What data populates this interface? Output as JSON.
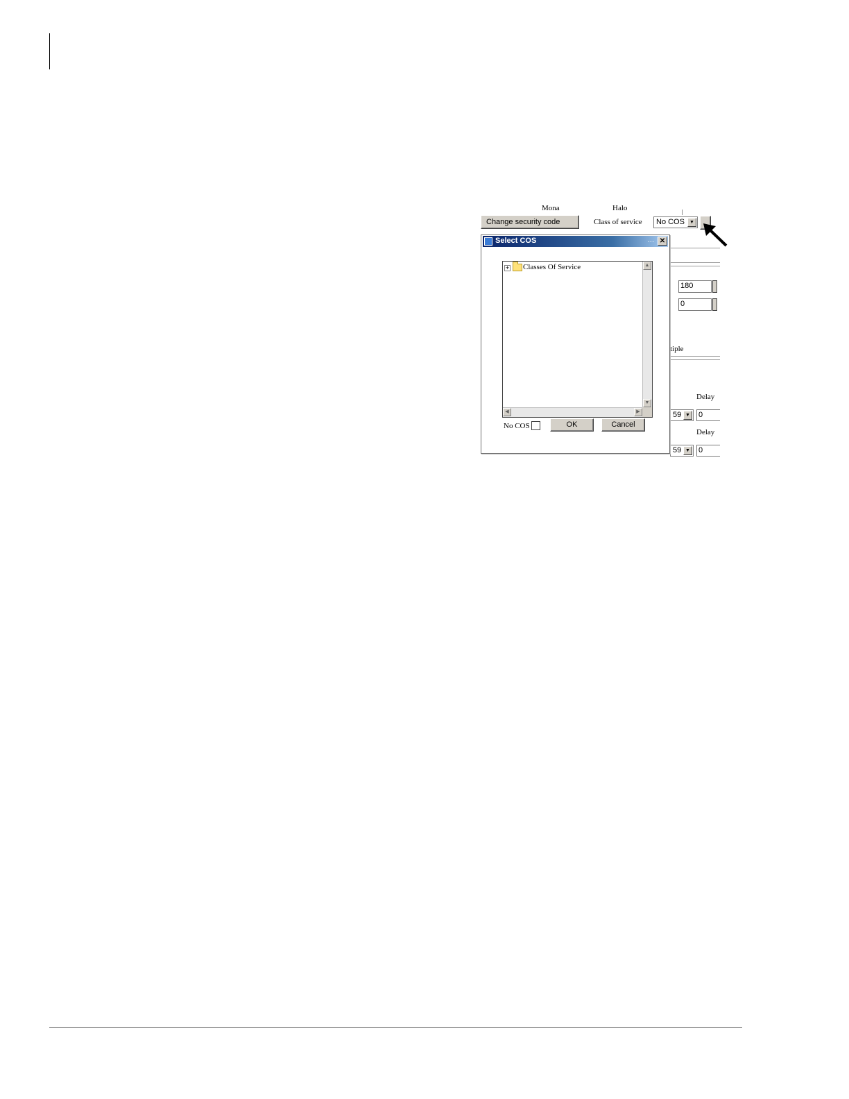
{
  "screen": {
    "cut_labels": [
      "Mona",
      "Halo"
    ],
    "change_security_code_label": "Change security code",
    "class_of_service_label": "Class of service",
    "class_of_service_value": "No COS",
    "field_1_value": "180",
    "field_2_value": "0",
    "partial_label": "tiple",
    "delay_label": "Delay",
    "row_1": {
      "select_value": "59",
      "delay_value": "0"
    },
    "row_2": {
      "select_value": "59",
      "delay_value": "0"
    }
  },
  "dialog": {
    "title": "Select COS",
    "title_dots": "...",
    "close_glyph": "✕",
    "tree_root_label": "Classes Of Service",
    "expander_glyph": "+",
    "no_cos_label": "No COS",
    "ok_label": "OK",
    "cancel_label": "Cancel"
  },
  "icons": {
    "callout": "arrow-pointer-icon",
    "folder": "folder-icon",
    "dialog": "app-window-icon"
  }
}
